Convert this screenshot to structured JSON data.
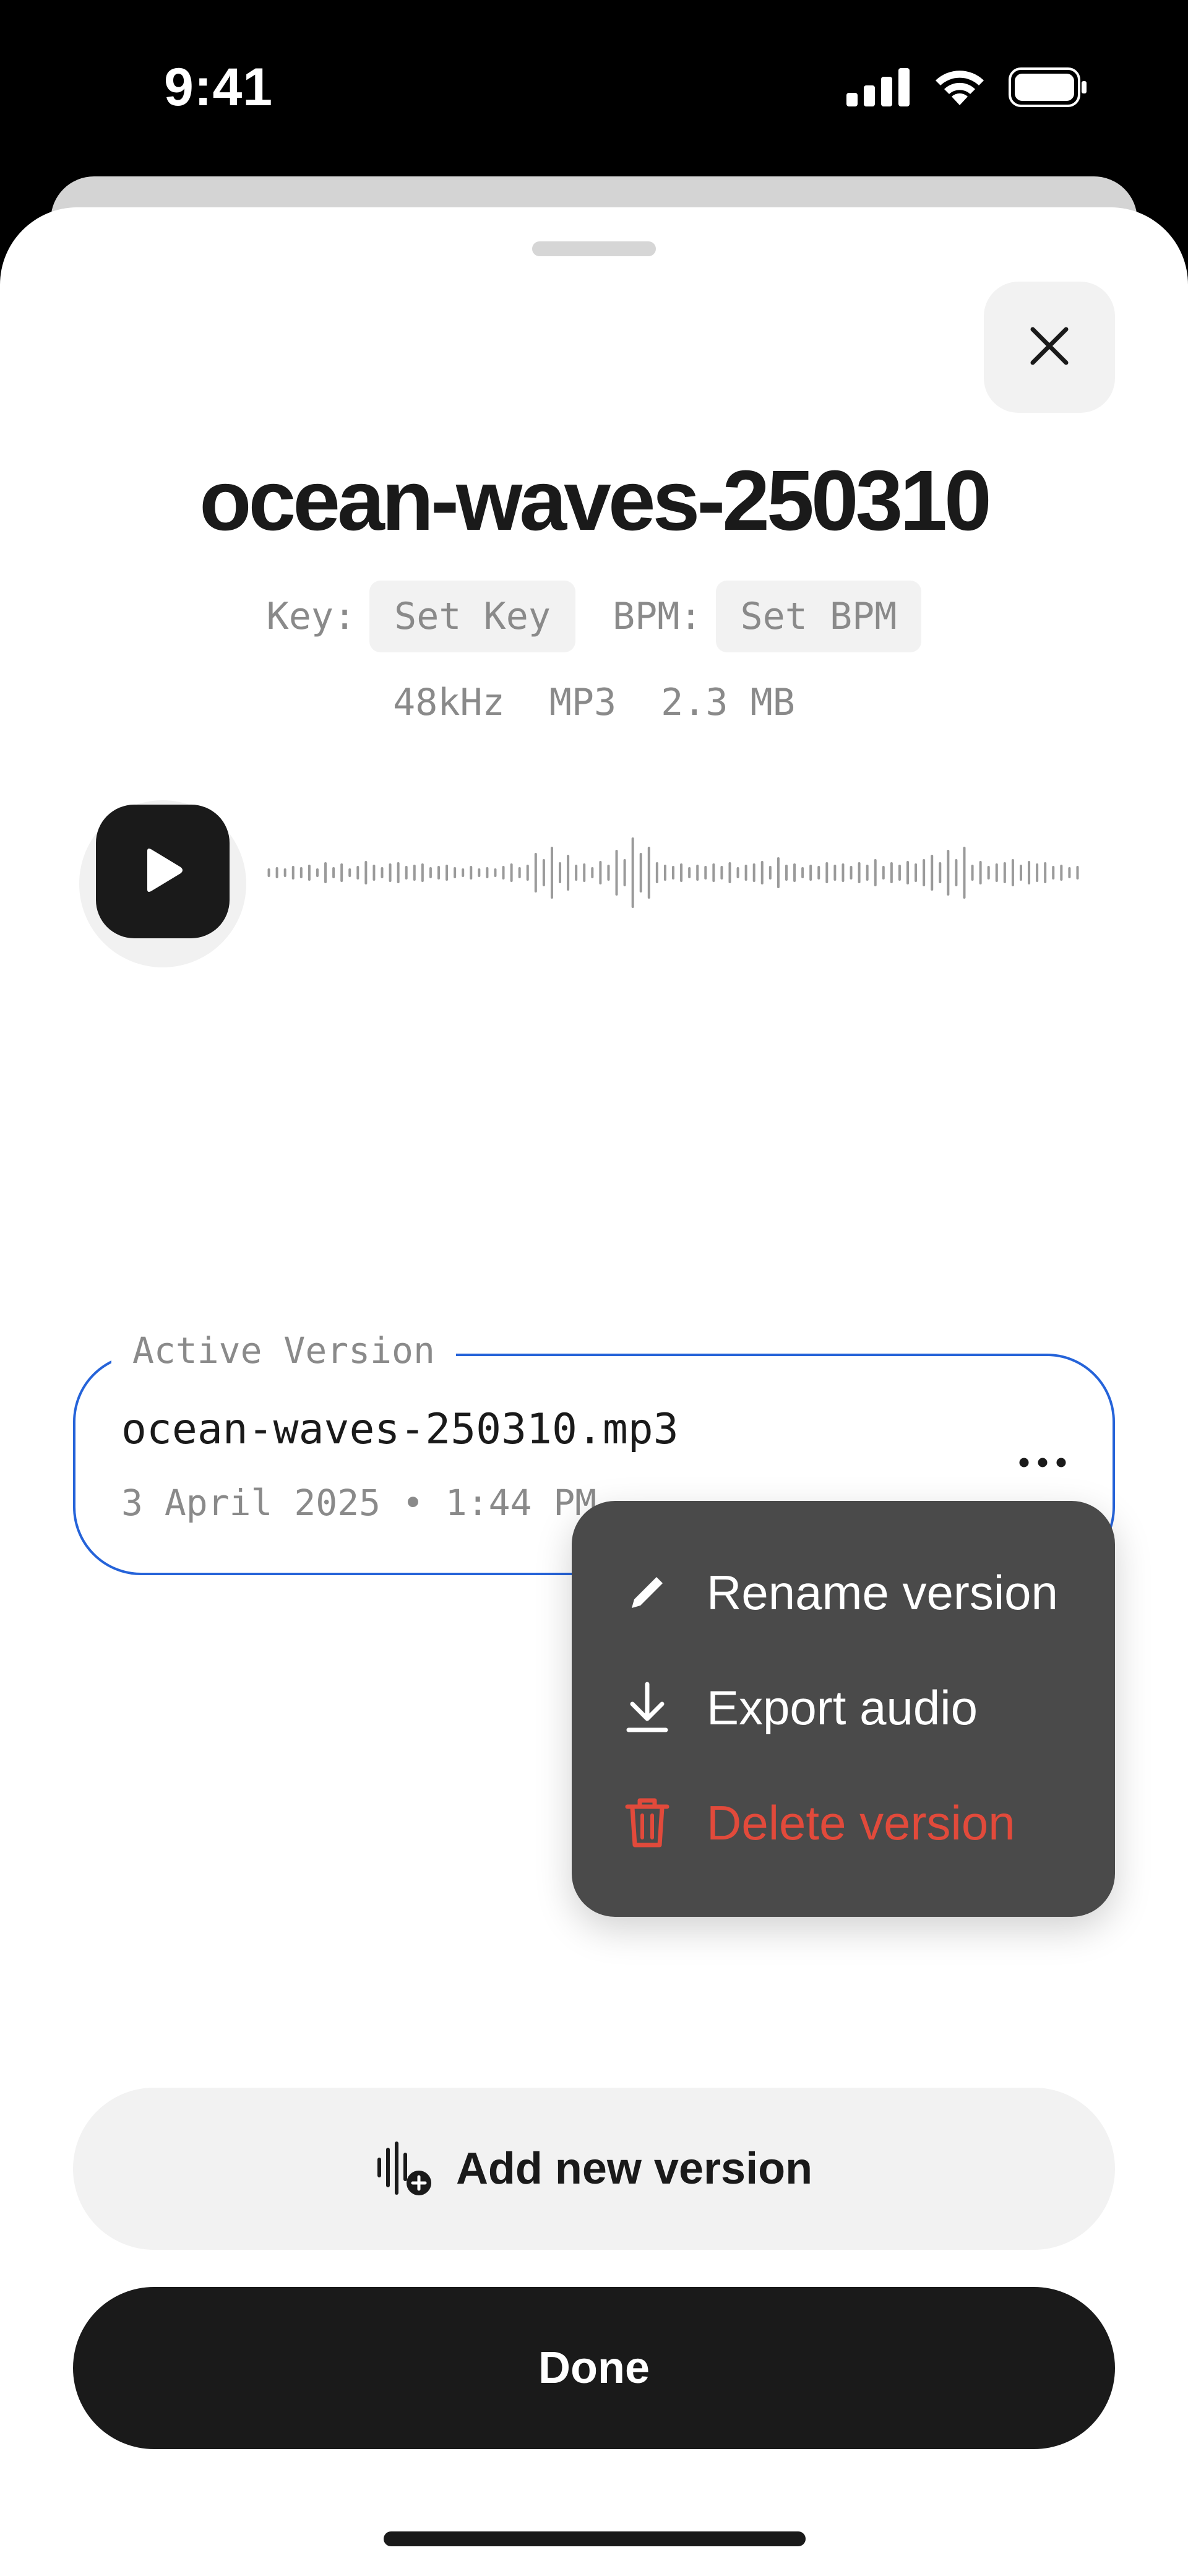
{
  "status_bar": {
    "time": "9:41",
    "icons": [
      "cellular-signal-icon",
      "wifi-icon",
      "battery-icon"
    ]
  },
  "sheet": {
    "title": "ocean-waves-250310",
    "key_label": "Key:",
    "key_value": "Set Key",
    "bpm_label": "BPM:",
    "bpm_value": "Set BPM",
    "file_info": {
      "sample_rate": "48kHz",
      "format": "MP3",
      "size": "2.3 MB"
    }
  },
  "player": {
    "play_icon": "play-icon",
    "waveform_icon": "waveform"
  },
  "active_version": {
    "label": "Active Version",
    "filename": "ocean-waves-250310.mp3",
    "date": "3 April 2025 • 1:44 PM",
    "more_icon": "more-horizontal-icon"
  },
  "context_menu": {
    "items": [
      {
        "label": "Rename version",
        "icon": "pencil-icon"
      },
      {
        "label": "Export audio",
        "icon": "download-icon"
      },
      {
        "label": "Delete version",
        "icon": "trash-icon"
      }
    ]
  },
  "actions": {
    "add_version_label": "Add new version",
    "add_version_icon": "waveform-plus-icon",
    "done_label": "Done"
  },
  "colors": {
    "accent_border": "#2563d9",
    "danger": "#e24a3b",
    "primary_dark": "#1a1a1a",
    "menu_background": "#4a4a4a"
  }
}
